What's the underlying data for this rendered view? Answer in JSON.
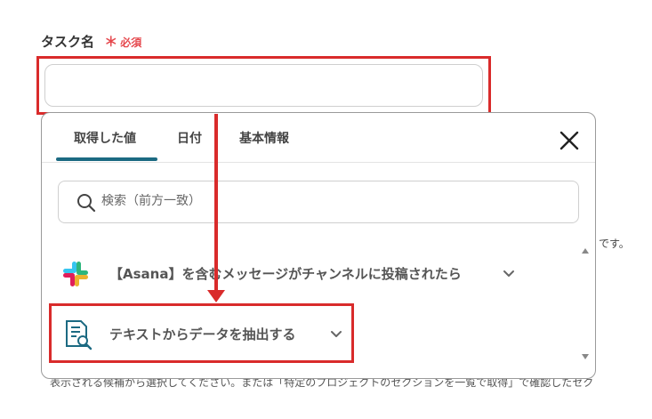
{
  "field": {
    "label": "タスク名",
    "required_mark": "＊",
    "required_text": "必須",
    "value": ""
  },
  "tabs": [
    {
      "label": "取得した値",
      "active": true
    },
    {
      "label": "日付",
      "active": false
    },
    {
      "label": "基本情報",
      "active": false
    }
  ],
  "search": {
    "placeholder": "検索（前方一致）"
  },
  "options": [
    {
      "label": "【Asana】を含むメッセージがチャンネルに投稿されたら",
      "icon": "slack-icon"
    },
    {
      "label": "テキストからデータを抽出する",
      "icon": "document-search-icon"
    }
  ],
  "background": {
    "desu": "です。",
    "hint": "表示される候補から選択してください。または「特定のプロジェクトのセクションを一覧で取得」で確認したセク"
  },
  "colors": {
    "accent": "#1c6a82",
    "required": "#e5484d",
    "annotation": "#d92b2b"
  }
}
